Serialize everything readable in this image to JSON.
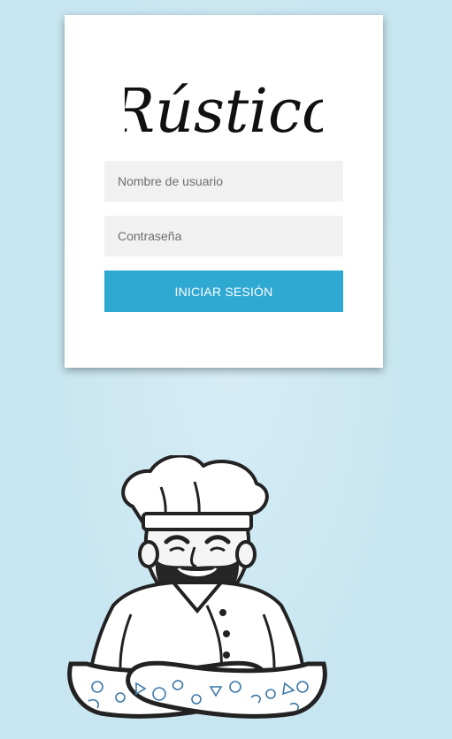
{
  "brand": {
    "logo_text": "Rústico"
  },
  "login": {
    "username_placeholder": "Nombre de usuario",
    "password_placeholder": "Contraseña",
    "submit_label": "INICIAR SESIÓN"
  },
  "colors": {
    "background": "#c8e6f1",
    "card": "#ffffff",
    "field": "#f1f1f1",
    "accent": "#2fa8d2"
  },
  "illustration": {
    "icon": "chef-mascot-icon"
  }
}
